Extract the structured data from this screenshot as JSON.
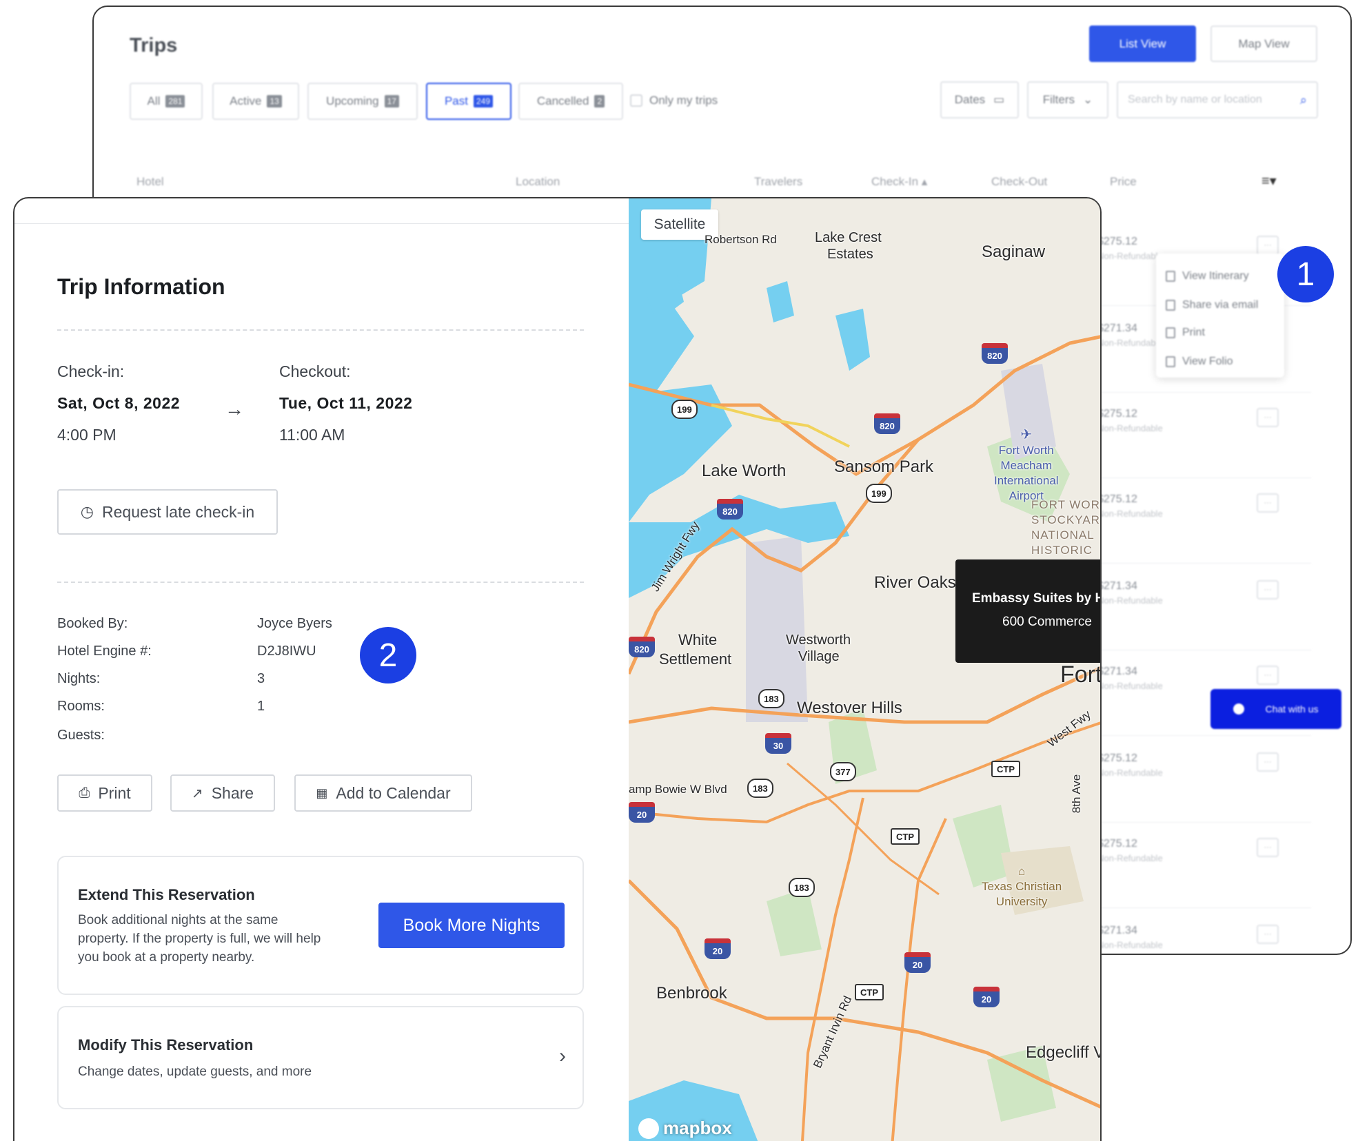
{
  "trips": {
    "title": "Trips",
    "list_view": "List View",
    "map_view": "Map View",
    "tabs": [
      {
        "label": "All",
        "count": "281"
      },
      {
        "label": "Active",
        "count": "13"
      },
      {
        "label": "Upcoming",
        "count": "17"
      },
      {
        "label": "Past",
        "count": "249"
      },
      {
        "label": "Cancelled",
        "count": "2"
      }
    ],
    "only_mine": "Only my trips",
    "dates": "Dates",
    "filters": "Filters",
    "search_placeholder": "Search by name or location",
    "columns": [
      "Hotel",
      "Location",
      "Travelers",
      "Check-In ▴",
      "Check-Out",
      "Price"
    ],
    "rows": [
      {
        "price": "$275.12",
        "refund": "Non-Refundable"
      },
      {
        "price": "$271.34",
        "refund": "Non-Refundable"
      },
      {
        "price": "$275.12",
        "refund": "Non-Refundable"
      },
      {
        "price": "$275.12",
        "refund": "Non-Refundable"
      },
      {
        "price": "$271.34",
        "refund": "Non-Refundable"
      },
      {
        "price": "$271.34",
        "refund": "Non-Refundable"
      },
      {
        "price": "$275.12",
        "refund": "Non-Refundable"
      },
      {
        "price": "$275.12",
        "refund": "Non-Refundable"
      },
      {
        "price": "$271.34",
        "refund": "Non-Refundable"
      }
    ],
    "menu": [
      "View Itinerary",
      "Share via email",
      "Print",
      "View Folio"
    ],
    "more_label": "···",
    "chat": "Chat with us"
  },
  "markers": {
    "one": "1",
    "two": "2"
  },
  "trip_info": {
    "title": "Trip Information",
    "checkin_label": "Check-in:",
    "checkin_date": "Sat, Oct 8, 2022",
    "checkin_time": "4:00 PM",
    "checkout_label": "Checkout:",
    "checkout_date": "Tue, Oct 11, 2022",
    "checkout_time": "11:00 AM",
    "arrow": "→",
    "late_checkin": "Request late check-in",
    "details": [
      {
        "label": "Booked By:",
        "value": "Joyce Byers"
      },
      {
        "label": "Hotel Engine #:",
        "value": "D2J8IWU"
      },
      {
        "label": "Nights:",
        "value": "3"
      },
      {
        "label": "Rooms:",
        "value": "1"
      },
      {
        "label": "Guests:",
        "value": ""
      }
    ],
    "print": "Print",
    "share": "Share",
    "add_calendar": "Add to Calendar",
    "extend_title": "Extend This Reservation",
    "extend_text_1": "Book additional nights at the same",
    "extend_text_2": "property. If the property is full, we will help",
    "extend_text_3": "you book at a property nearby.",
    "book_more": "Book More Nights",
    "modify_title": "Modify This Reservation",
    "modify_text": "Change dates, update guests, and more",
    "chevron": "›"
  },
  "map": {
    "satellite": "Satellite",
    "tooltip_name": "Embassy Suites by H",
    "tooltip_address": "600 Commerce",
    "attribution": "mapbox",
    "labels": [
      {
        "text": "Robertson Rd"
      },
      {
        "text": "Lake Crest"
      },
      {
        "text": "Estates"
      },
      {
        "text": "Saginaw"
      },
      {
        "text": "Lake Worth"
      },
      {
        "text": "Sansom Park"
      },
      {
        "text": "River Oaks"
      },
      {
        "text": "White"
      },
      {
        "text": "Settlement"
      },
      {
        "text": "Westworth"
      },
      {
        "text": "Village"
      },
      {
        "text": "Westover Hills"
      },
      {
        "text": "Fort"
      },
      {
        "text": "Benbrook"
      },
      {
        "text": "Edgecliff V"
      },
      {
        "text": "amp Bowie W Blvd"
      },
      {
        "text": "Jim Wright Fwy"
      },
      {
        "text": "West Fwy"
      },
      {
        "text": "8th Ave"
      },
      {
        "text": "Bryant Irvin Rd"
      }
    ],
    "poi_airport": [
      "Fort Worth",
      "Meacham",
      "International",
      "Airport"
    ],
    "poi_stockyards": [
      "FORT WORT",
      "STOCKYAR",
      "NATIONAL",
      "HISTORIC"
    ],
    "poi_tcu": [
      "Texas Christian",
      "University"
    ],
    "shields_interstate": [
      "820",
      "820",
      "820",
      "820",
      "30",
      "20",
      "20",
      "20",
      "20"
    ],
    "shields_state": [
      "199",
      "199",
      "183",
      "377",
      "183",
      "183"
    ],
    "shields_road": [
      "CTP",
      "CTP",
      "CTP"
    ]
  }
}
